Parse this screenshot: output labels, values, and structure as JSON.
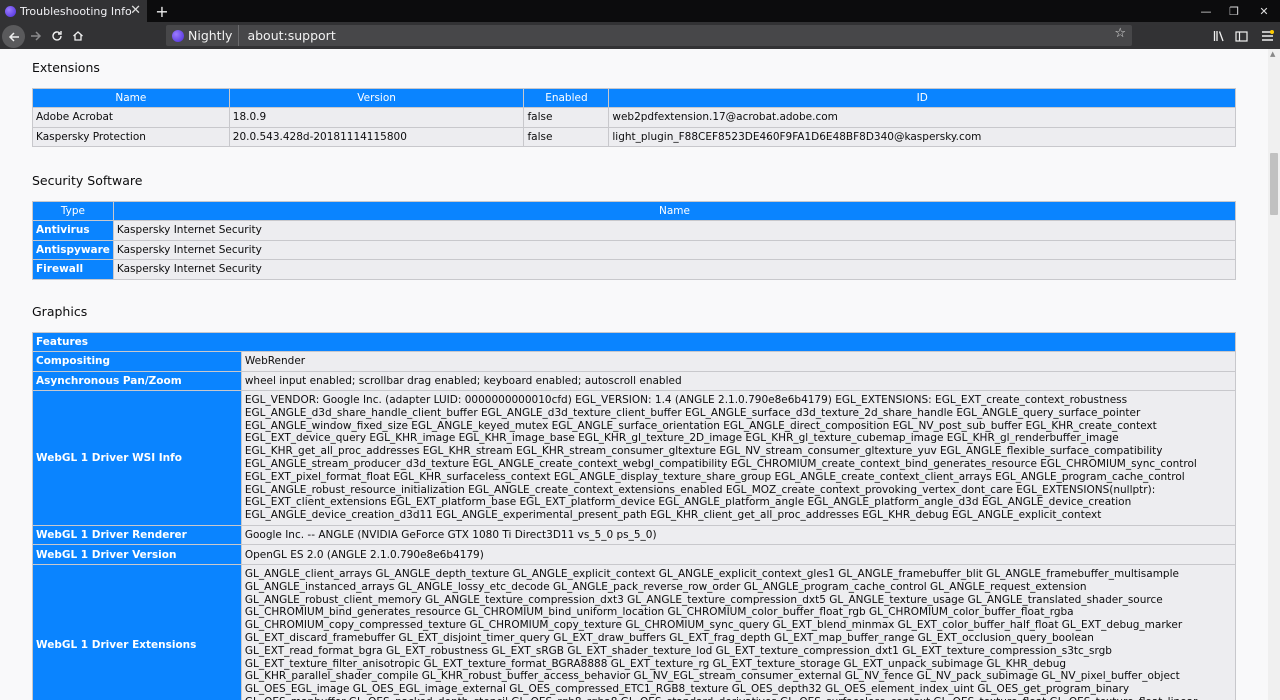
{
  "tab": {
    "title": "Troubleshooting Inform",
    "close": "✕",
    "new_tab": "+"
  },
  "window": {
    "minimize": "—",
    "restore": "❐",
    "close": "✕"
  },
  "nav": {
    "identity_label": "Nightly",
    "url": "about:support"
  },
  "extensions": {
    "heading": "Extensions",
    "columns": [
      "Name",
      "Version",
      "Enabled",
      "ID"
    ],
    "rows": [
      {
        "name": "Adobe Acrobat",
        "version": "18.0.9",
        "enabled": "false",
        "id": "web2pdfextension.17@acrobat.adobe.com"
      },
      {
        "name": "Kaspersky Protection",
        "version": "20.0.543.428d-20181114115800",
        "enabled": "false",
        "id": "light_plugin_F88CEF8523DE460F9FA1D6E48BF8D340@kaspersky.com"
      }
    ]
  },
  "security": {
    "heading": "Security Software",
    "columns": [
      "Type",
      "Name"
    ],
    "rows": [
      {
        "type": "Antivirus",
        "name": "Kaspersky Internet Security"
      },
      {
        "type": "Antispyware",
        "name": "Kaspersky Internet Security"
      },
      {
        "type": "Firewall",
        "name": "Kaspersky Internet Security"
      }
    ]
  },
  "graphics": {
    "heading": "Graphics",
    "features_header": "Features",
    "rows": [
      {
        "label": "Compositing",
        "value": "WebRender"
      },
      {
        "label": "Asynchronous Pan/Zoom",
        "value": "wheel input enabled; scrollbar drag enabled; keyboard enabled; autoscroll enabled"
      },
      {
        "label": "WebGL 1 Driver WSI Info",
        "value": "EGL_VENDOR: Google Inc. (adapter LUID: 0000000000010cfd) EGL_VERSION: 1.4 (ANGLE 2.1.0.790e8e6b4179) EGL_EXTENSIONS: EGL_EXT_create_context_robustness EGL_ANGLE_d3d_share_handle_client_buffer EGL_ANGLE_d3d_texture_client_buffer EGL_ANGLE_surface_d3d_texture_2d_share_handle EGL_ANGLE_query_surface_pointer EGL_ANGLE_window_fixed_size EGL_ANGLE_keyed_mutex EGL_ANGLE_surface_orientation EGL_ANGLE_direct_composition EGL_NV_post_sub_buffer EGL_KHR_create_context EGL_EXT_device_query EGL_KHR_image EGL_KHR_image_base EGL_KHR_gl_texture_2D_image EGL_KHR_gl_texture_cubemap_image EGL_KHR_gl_renderbuffer_image EGL_KHR_get_all_proc_addresses EGL_KHR_stream EGL_KHR_stream_consumer_gltexture EGL_NV_stream_consumer_gltexture_yuv EGL_ANGLE_flexible_surface_compatibility EGL_ANGLE_stream_producer_d3d_texture EGL_ANGLE_create_context_webgl_compatibility EGL_CHROMIUM_create_context_bind_generates_resource EGL_CHROMIUM_sync_control EGL_EXT_pixel_format_float EGL_KHR_surfaceless_context EGL_ANGLE_display_texture_share_group EGL_ANGLE_create_context_client_arrays EGL_ANGLE_program_cache_control EGL_ANGLE_robust_resource_initialization EGL_ANGLE_create_context_extensions_enabled EGL_MOZ_create_context_provoking_vertex_dont_care EGL_EXTENSIONS(nullptr): EGL_EXT_client_extensions EGL_EXT_platform_base EGL_EXT_platform_device EGL_ANGLE_platform_angle EGL_ANGLE_platform_angle_d3d EGL_ANGLE_device_creation EGL_ANGLE_device_creation_d3d11 EGL_ANGLE_experimental_present_path EGL_KHR_client_get_all_proc_addresses EGL_KHR_debug EGL_ANGLE_explicit_context"
      },
      {
        "label": "WebGL 1 Driver Renderer",
        "value": "Google Inc. -- ANGLE (NVIDIA GeForce GTX 1080 Ti Direct3D11 vs_5_0 ps_5_0)"
      },
      {
        "label": "WebGL 1 Driver Version",
        "value": "OpenGL ES 2.0 (ANGLE 2.1.0.790e8e6b4179)"
      },
      {
        "label": "WebGL 1 Driver Extensions",
        "value": "GL_ANGLE_client_arrays GL_ANGLE_depth_texture GL_ANGLE_explicit_context GL_ANGLE_explicit_context_gles1 GL_ANGLE_framebuffer_blit GL_ANGLE_framebuffer_multisample GL_ANGLE_instanced_arrays GL_ANGLE_lossy_etc_decode GL_ANGLE_pack_reverse_row_order GL_ANGLE_program_cache_control GL_ANGLE_request_extension GL_ANGLE_robust_client_memory GL_ANGLE_texture_compression_dxt3 GL_ANGLE_texture_compression_dxt5 GL_ANGLE_texture_usage GL_ANGLE_translated_shader_source GL_CHROMIUM_bind_generates_resource GL_CHROMIUM_bind_uniform_location GL_CHROMIUM_color_buffer_float_rgb GL_CHROMIUM_color_buffer_float_rgba GL_CHROMIUM_copy_compressed_texture GL_CHROMIUM_copy_texture GL_CHROMIUM_sync_query GL_EXT_blend_minmax GL_EXT_color_buffer_half_float GL_EXT_debug_marker GL_EXT_discard_framebuffer GL_EXT_disjoint_timer_query GL_EXT_draw_buffers GL_EXT_frag_depth GL_EXT_map_buffer_range GL_EXT_occlusion_query_boolean GL_EXT_read_format_bgra GL_EXT_robustness GL_EXT_sRGB GL_EXT_shader_texture_lod GL_EXT_texture_compression_dxt1 GL_EXT_texture_compression_s3tc_srgb GL_EXT_texture_filter_anisotropic GL_EXT_texture_format_BGRA8888 GL_EXT_texture_rg GL_EXT_texture_storage GL_EXT_unpack_subimage GL_KHR_debug GL_KHR_parallel_shader_compile GL_KHR_robust_buffer_access_behavior GL_NV_EGL_stream_consumer_external GL_NV_fence GL_NV_pack_subimage GL_NV_pixel_buffer_object GL_OES_EGL_image GL_OES_EGL_image_external GL_OES_compressed_ETC1_RGB8_texture GL_OES_depth32 GL_OES_element_index_uint GL_OES_get_program_binary GL_OES_mapbuffer GL_OES_packed_depth_stencil GL_OES_rgb8_rgba8 GL_OES_standard_derivatives GL_OES_surfaceless_context GL_OES_texture_float GL_OES_texture_float_linear GL_OES_texture_half_float GL_OES_texture_half_float_linear GL_OES_texture_npot"
      }
    ]
  }
}
